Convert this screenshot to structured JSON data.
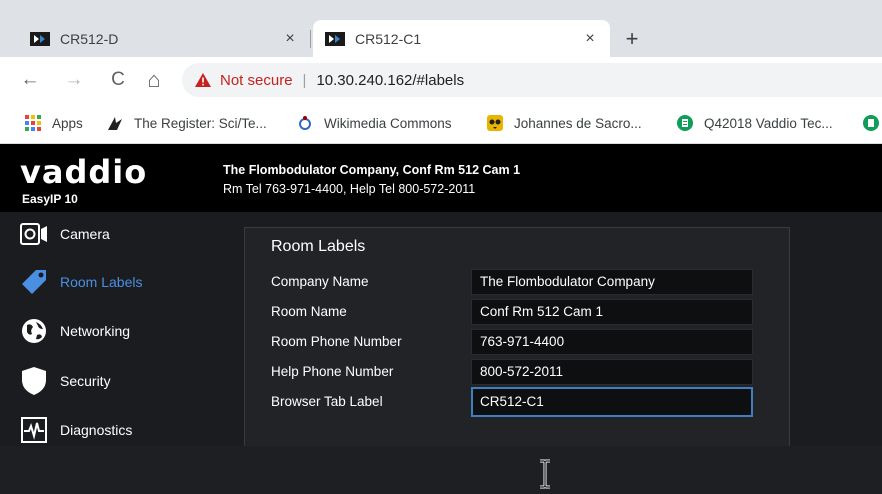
{
  "browser": {
    "tabs": [
      {
        "title": "CR512-D",
        "close": "×",
        "active": false
      },
      {
        "title": "CR512-C1",
        "close": "×",
        "active": true
      }
    ],
    "new_tab": "+",
    "nav": {
      "back": "←",
      "forward": "→",
      "reload": "C",
      "home": "⌂"
    },
    "security_label": "Not secure",
    "separator": "|",
    "url": "10.30.240.162/#labels",
    "bookmarks": [
      {
        "label": "Apps",
        "icon": "apps-grid-icon"
      },
      {
        "label": "The Register: Sci/Te...",
        "icon": "register-icon"
      },
      {
        "label": "Wikimedia Commons",
        "icon": "wikimedia-icon"
      },
      {
        "label": "Johannes de Sacro...",
        "icon": "owl-icon"
      },
      {
        "label": "Q42018 Vaddio Tec...",
        "icon": "sheets-icon"
      }
    ]
  },
  "app": {
    "logo": "vaddio",
    "product": "EasyIP 10",
    "header_line1": "The Flombodulator Company, Conf Rm 512 Cam 1",
    "header_line2": "Rm Tel 763-971-4400, Help Tel 800-572-2011",
    "accent_color": "#4a90e2",
    "sidebar": [
      {
        "label": "Camera",
        "icon": "camera-icon",
        "active": false
      },
      {
        "label": "Room Labels",
        "icon": "tag-icon",
        "active": true
      },
      {
        "label": "Networking",
        "icon": "globe-icon",
        "active": false
      },
      {
        "label": "Security",
        "icon": "shield-icon",
        "active": false
      },
      {
        "label": "Diagnostics",
        "icon": "diagnostics-icon",
        "active": false
      }
    ],
    "panel": {
      "title": "Room Labels",
      "fields": [
        {
          "label": "Company Name",
          "value": "The Flombodulator Company"
        },
        {
          "label": "Room Name",
          "value": "Conf Rm 512 Cam 1"
        },
        {
          "label": "Room Phone Number",
          "value": "763-971-4400"
        },
        {
          "label": "Help Phone Number",
          "value": "800-572-2011"
        },
        {
          "label": "Browser Tab Label",
          "value": "CR512-C1"
        }
      ]
    }
  }
}
